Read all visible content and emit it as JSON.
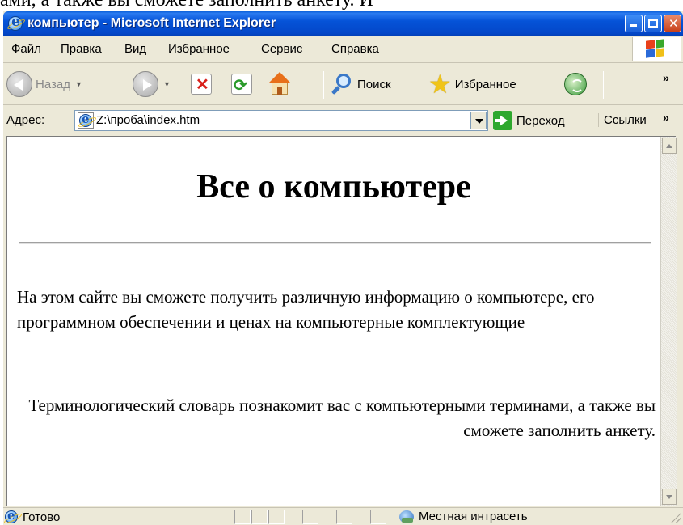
{
  "background_text": "ами, а также вы сможете заполнить анкету. И",
  "window": {
    "title": "компьютер - Microsoft Internet Explorer"
  },
  "menu": {
    "items": [
      "Файл",
      "Правка",
      "Вид",
      "Избранное",
      "Сервис",
      "Справка"
    ]
  },
  "toolbar": {
    "back_label": "Назад",
    "search_label": "Поиск",
    "favorites_label": "Избранное"
  },
  "address": {
    "label": "Адрес:",
    "value": "Z:\\проба\\index.htm",
    "go_label": "Переход",
    "links_label": "Ссылки"
  },
  "page": {
    "heading": "Все о компьютере",
    "paragraph1": "На этом сайте вы сможете получить различную информацию о компьютере, его программном обеспечении и ценах на компьютерные комплектующие",
    "paragraph2": "Терминологический словарь познакомит вас с компьютерными терминами, а также вы сможете заполнить анкету."
  },
  "status": {
    "text": "Готово",
    "zone": "Местная интрасеть"
  }
}
